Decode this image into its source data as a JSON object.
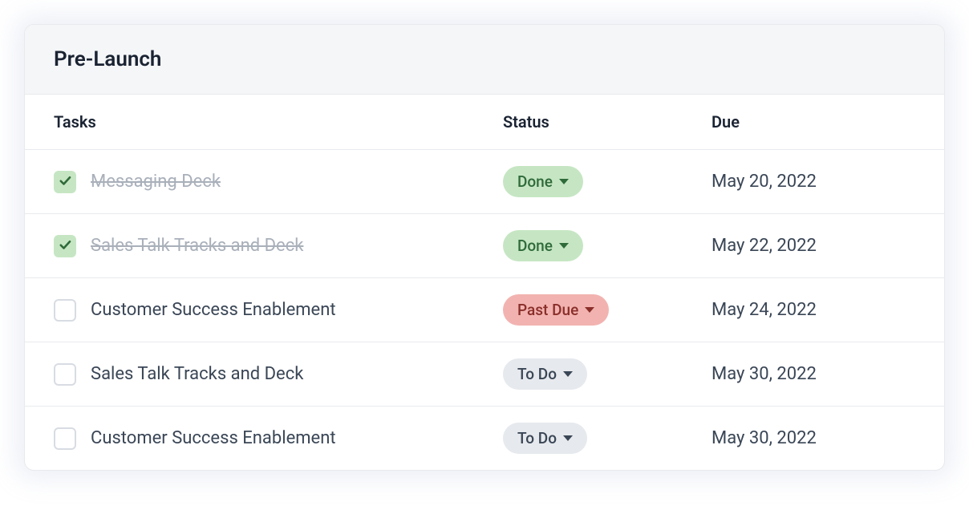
{
  "section": {
    "title": "Pre-Launch"
  },
  "columns": {
    "tasks": "Tasks",
    "status": "Status",
    "due": "Due"
  },
  "status_labels": {
    "done": "Done",
    "pastdue": "Past Due",
    "todo": "To Do"
  },
  "rows": [
    {
      "name": "Messaging Deck",
      "checked": true,
      "status": "done",
      "due": "May 20, 2022"
    },
    {
      "name": "Sales Talk Tracks and Deck",
      "checked": true,
      "status": "done",
      "due": "May 22, 2022"
    },
    {
      "name": "Customer Success Enablement",
      "checked": false,
      "status": "pastdue",
      "due": "May 24, 2022"
    },
    {
      "name": "Sales Talk Tracks and Deck",
      "checked": false,
      "status": "todo",
      "due": "May 30, 2022"
    },
    {
      "name": "Customer Success Enablement",
      "checked": false,
      "status": "todo",
      "due": "May 30, 2022"
    }
  ]
}
